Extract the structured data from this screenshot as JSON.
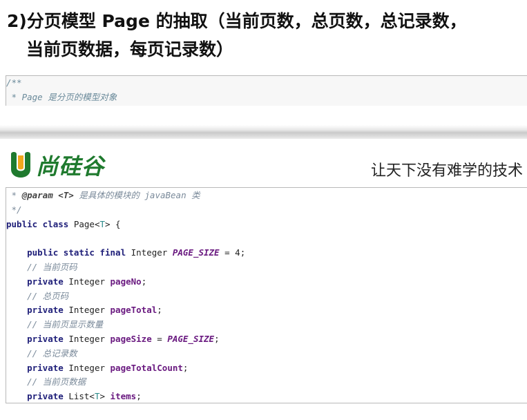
{
  "heading": {
    "line1": "2)分页模型 Page 的抽取（当前页数，总页数，总记录数，",
    "line2": "当前页数据，每页记录数）"
  },
  "snippet_top": {
    "lines": [
      "/**",
      " * Page 是分页的模型对象"
    ]
  },
  "brand": {
    "logo_text": "尚硅谷",
    "slogan": "让天下没有难学的技术",
    "logo_color": "#1f7a2e",
    "logo_accent": "#f2a81d"
  },
  "code": {
    "l1_star": " * ",
    "l1_tag": "@param",
    "l1_gen": " <T>",
    "l1_rest": " 是具体的模块的 javaBean 类",
    "l2": " */",
    "l3_kw": "public class",
    "l3_name": " Page<",
    "l3_gen": "T",
    "l3_end": "> {",
    "l5_kw": "public static final",
    "l5_type": " Integer ",
    "l5_const": "PAGE_SIZE",
    "l5_eq": " = ",
    "l5_num": "4",
    "l5_end": ";",
    "c_pageNo": "// 当前页码",
    "kw_private": "private",
    "t_integer": " Integer ",
    "f_pageNo": "pageNo",
    "c_pageTotal": "// 总页码",
    "f_pageTotal": "pageTotal",
    "c_pageSize": "// 当前页显示数量",
    "f_pageSize": "pageSize",
    "eq": " = ",
    "const_ref": "PAGE_SIZE",
    "c_count": "// 总记录数",
    "f_count": "pageTotalCount",
    "c_items": "// 当前页数据",
    "t_list": " List<",
    "t_gen": "T",
    "t_close": "> ",
    "f_items": "items",
    "semi": ";"
  }
}
